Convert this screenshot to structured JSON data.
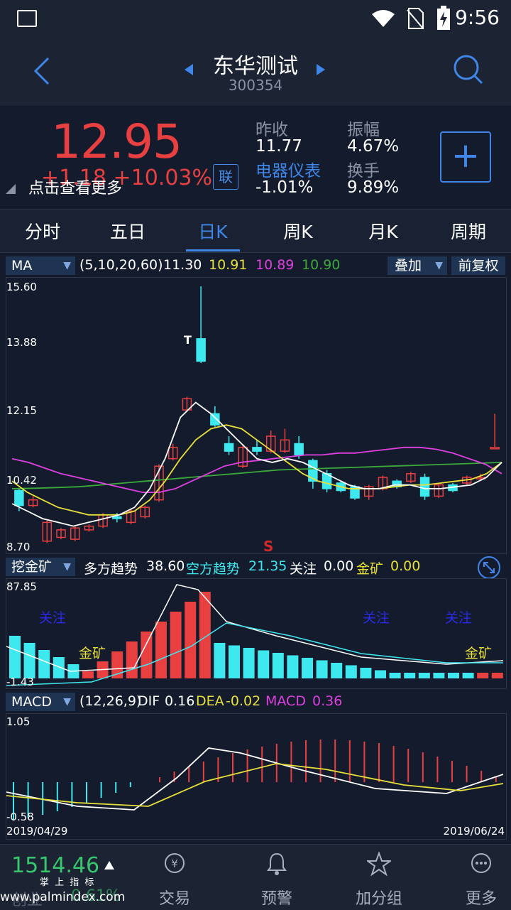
{
  "status": {
    "time": "9:56"
  },
  "header": {
    "title": "东华测试",
    "code": "300354"
  },
  "quote": {
    "price": "12.95",
    "change": "+1.18  +10.03%",
    "hint": "点击查看更多",
    "lian": "联",
    "prev_close_label": "昨收",
    "prev_close": "11.77",
    "amplitude_label": "振幅",
    "amplitude": "4.67%",
    "sector_label": "电器仪表",
    "sector_change": "-1.01%",
    "turnover_label": "换手",
    "turnover": "9.89%",
    "add_label": "+"
  },
  "tabs": [
    "分时",
    "五日",
    "日K",
    "周K",
    "月K",
    "周期"
  ],
  "active_tab": "日K",
  "ma_bar": {
    "selector": "MA",
    "params": "(5,10,20,60)",
    "v5": "11.30",
    "v10": "10.91",
    "v20": "10.89",
    "v60": "10.90",
    "overlay": "叠加",
    "adjust": "前复权",
    "y_max": "15.60",
    "y2": "13.88",
    "y3": "12.15",
    "y4": "10.42",
    "y_min": "8.70",
    "signal_s": "S",
    "signal_t": "T"
  },
  "wjk_bar": {
    "selector": "挖金矿",
    "bull_label": "多方趋势",
    "bull": "38.60",
    "bear_label": "空方趋势",
    "bear": "21.35",
    "focus_label": "关注",
    "focus": "0.00",
    "gold_label": "金矿",
    "gold": "0.00",
    "y_max": "87.85",
    "y_min": "-1.43",
    "tag_focus": "关注",
    "tag_gold": "金矿"
  },
  "macd_bar": {
    "selector": "MACD",
    "params": "(12,26,9)",
    "dif_label": "DIF",
    "dif": "0.16",
    "dea_label": "DEA",
    "dea": "-0.02",
    "macd_label": "MACD",
    "macd": "0.36",
    "y_max": "1.05",
    "y_min": "-0.58",
    "date_start": "2019/04/29",
    "date_end": "2019/06/24"
  },
  "bottom": {
    "index_value": "1514.46",
    "index_sub": "掌 上 指 标",
    "index_name": "创业",
    "index_change": "0.61%",
    "watermark": "www.palmindex.com",
    "items": [
      "交易",
      "预警",
      "加分组",
      "更多"
    ]
  },
  "colors": {
    "up": "#e84040",
    "down": "#3ee8ef",
    "accent": "#3f86e8",
    "ma5": "#ffffff",
    "ma10": "#e8e03a",
    "ma20": "#e040e0",
    "ma60": "#3aa83a"
  },
  "chart_data": {
    "type": "candlestick",
    "dates": [
      "2019/04/29",
      "2019/06/24"
    ],
    "ylim": [
      8.7,
      15.6
    ],
    "candles": [
      {
        "o": 10.15,
        "c": 9.75,
        "h": 10.2,
        "l": 9.6
      },
      {
        "o": 9.75,
        "c": 9.9,
        "h": 10.0,
        "l": 9.7
      },
      {
        "o": 8.8,
        "c": 9.3,
        "h": 9.35,
        "l": 8.75
      },
      {
        "o": 8.9,
        "c": 9.1,
        "h": 9.15,
        "l": 8.85
      },
      {
        "o": 8.85,
        "c": 9.15,
        "h": 9.2,
        "l": 8.8
      },
      {
        "o": 9.1,
        "c": 9.2,
        "h": 9.25,
        "l": 9.05
      },
      {
        "o": 9.2,
        "c": 9.5,
        "h": 9.55,
        "l": 9.15
      },
      {
        "o": 9.45,
        "c": 9.4,
        "h": 9.55,
        "l": 9.3
      },
      {
        "o": 9.3,
        "c": 9.6,
        "h": 9.65,
        "l": 9.25
      },
      {
        "o": 9.45,
        "c": 9.7,
        "h": 9.75,
        "l": 9.4
      },
      {
        "o": 9.9,
        "c": 10.8,
        "h": 10.85,
        "l": 9.85
      },
      {
        "o": 11.0,
        "c": 11.3,
        "h": 11.4,
        "l": 10.95
      },
      {
        "o": 12.3,
        "c": 12.6,
        "h": 12.65,
        "l": 12.25
      },
      {
        "o": 14.2,
        "c": 13.6,
        "h": 15.6,
        "l": 13.55
      },
      {
        "o": 12.2,
        "c": 11.9,
        "h": 12.4,
        "l": 11.85
      },
      {
        "o": 11.4,
        "c": 11.2,
        "h": 11.6,
        "l": 11.1
      },
      {
        "o": 10.8,
        "c": 11.3,
        "h": 11.35,
        "l": 10.75
      },
      {
        "o": 11.3,
        "c": 11.2,
        "h": 11.5,
        "l": 11.1
      },
      {
        "o": 11.2,
        "c": 11.6,
        "h": 11.75,
        "l": 11.15
      },
      {
        "o": 11.2,
        "c": 11.5,
        "h": 11.8,
        "l": 11.15
      },
      {
        "o": 11.4,
        "c": 11.1,
        "h": 11.6,
        "l": 11.0
      },
      {
        "o": 10.95,
        "c": 10.4,
        "h": 11.0,
        "l": 10.2
      },
      {
        "o": 10.6,
        "c": 10.2,
        "h": 10.7,
        "l": 10.1
      },
      {
        "o": 10.35,
        "c": 10.15,
        "h": 10.4,
        "l": 10.1
      },
      {
        "o": 10.25,
        "c": 9.95,
        "h": 10.3,
        "l": 9.9
      },
      {
        "o": 10.0,
        "c": 10.25,
        "h": 10.3,
        "l": 9.9
      },
      {
        "o": 10.2,
        "c": 10.5,
        "h": 10.55,
        "l": 10.15
      },
      {
        "o": 10.4,
        "c": 10.25,
        "h": 10.45,
        "l": 10.2
      },
      {
        "o": 10.4,
        "c": 10.6,
        "h": 10.65,
        "l": 10.35
      },
      {
        "o": 10.5,
        "c": 10.0,
        "h": 10.6,
        "l": 9.9
      },
      {
        "o": 10.0,
        "c": 10.3,
        "h": 10.35,
        "l": 9.95
      },
      {
        "o": 10.3,
        "c": 10.15,
        "h": 10.35,
        "l": 10.1
      },
      {
        "o": 10.35,
        "c": 10.5,
        "h": 10.55,
        "l": 10.3
      },
      {
        "o": 10.5,
        "c": 10.5,
        "h": 10.6,
        "l": 10.4
      },
      {
        "o": 11.3,
        "c": 11.3,
        "h": 12.2,
        "l": 11.3
      }
    ],
    "ma5": [
      9.8,
      9.6,
      9.4,
      9.3,
      9.2,
      9.3,
      9.4,
      9.5,
      9.7,
      10.2,
      11.0,
      12.1,
      12.5,
      12.2,
      11.8,
      11.4,
      11.0,
      10.9,
      11.0,
      10.9,
      10.7,
      10.5,
      10.3,
      10.2,
      10.2,
      10.3,
      10.3,
      10.2,
      10.2,
      10.25,
      10.3,
      10.5,
      10.9
    ],
    "ma10": [
      10.4,
      10.1,
      9.9,
      9.7,
      9.6,
      9.5,
      9.5,
      9.5,
      9.6,
      9.9,
      10.4,
      11.0,
      11.5,
      11.8,
      11.9,
      11.8,
      11.5,
      11.2,
      10.9,
      10.6,
      10.4,
      10.3,
      10.2,
      10.2,
      10.2,
      10.25,
      10.3,
      10.3,
      10.35,
      10.4,
      10.45,
      10.6,
      10.9
    ],
    "ma20": [
      11.0,
      10.9,
      10.75,
      10.6,
      10.5,
      10.4,
      10.3,
      10.2,
      10.1,
      10.1,
      10.2,
      10.4,
      10.6,
      10.8,
      10.9,
      10.95,
      11.0,
      11.05,
      11.1,
      11.1,
      11.15,
      11.15,
      11.2,
      11.25,
      11.3,
      11.3,
      11.25,
      11.15,
      11.0,
      10.85,
      10.6
    ],
    "ma60": [
      10.2,
      10.21,
      10.23,
      10.25,
      10.3,
      10.35,
      10.4,
      10.45,
      10.5,
      10.55,
      10.6,
      10.65,
      10.7,
      10.72,
      10.74,
      10.76,
      10.78,
      10.8,
      10.82,
      10.84,
      10.86,
      10.88,
      10.9
    ]
  }
}
